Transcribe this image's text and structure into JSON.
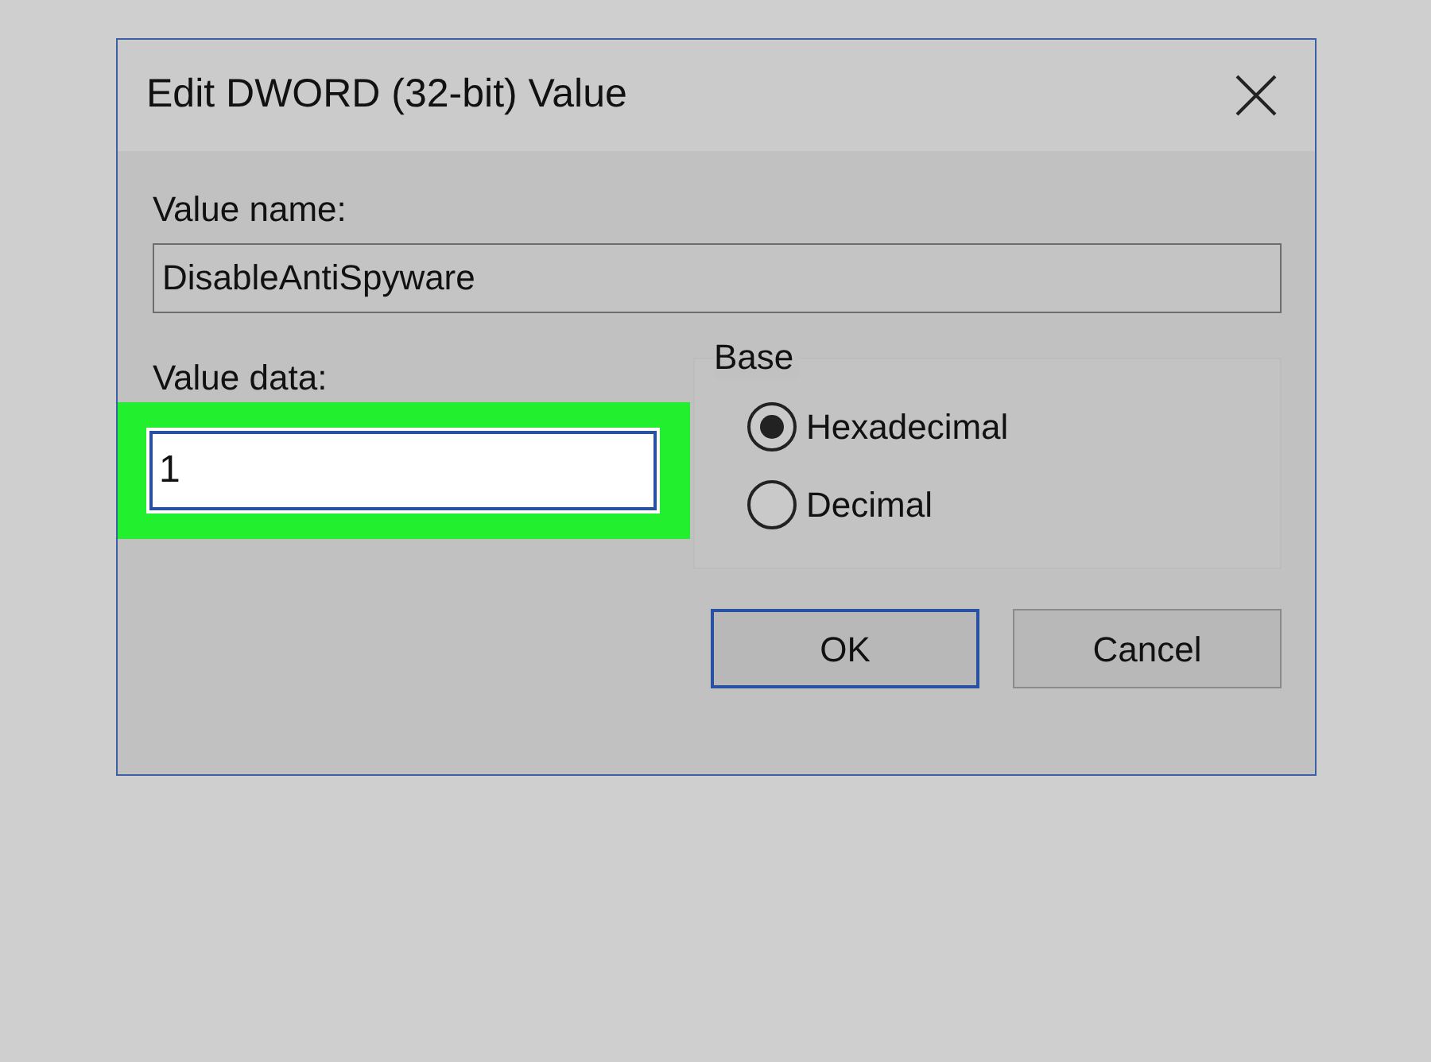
{
  "window": {
    "title": "Edit DWORD (32-bit) Value"
  },
  "value_name": {
    "label": "Value name:",
    "value": "DisableAntiSpyware"
  },
  "value_data": {
    "label": "Value data:",
    "value": "1",
    "highlighted": true
  },
  "base": {
    "title": "Base",
    "options": [
      {
        "label": "Hexadecimal",
        "selected": true
      },
      {
        "label": "Decimal",
        "selected": false
      }
    ]
  },
  "buttons": [
    {
      "label": "OK",
      "default": true
    },
    {
      "label": "Cancel",
      "default": false
    }
  ]
}
